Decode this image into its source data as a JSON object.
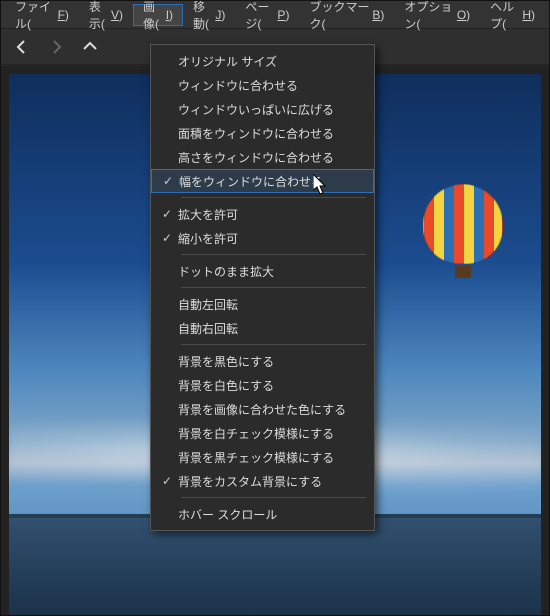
{
  "menubar": {
    "items": [
      {
        "label": "ファイル(F)"
      },
      {
        "label": "表示(V)"
      },
      {
        "label": "画像(I)",
        "active": true
      },
      {
        "label": "移動(J)"
      },
      {
        "label": "ページ(P)"
      },
      {
        "label": "ブックマーク(B)"
      },
      {
        "label": "オプション(O)"
      },
      {
        "label": "ヘルプ(H)"
      }
    ]
  },
  "toolbar": {
    "back_title": "戻る",
    "forward_title": "進む",
    "up_title": "上へ"
  },
  "dropdown": {
    "items": [
      {
        "label": "オリジナル サイズ"
      },
      {
        "label": "ウィンドウに合わせる"
      },
      {
        "label": "ウィンドウいっぱいに広げる"
      },
      {
        "label": "面積をウィンドウに合わせる"
      },
      {
        "label": "高さをウィンドウに合わせる"
      },
      {
        "label": "幅をウィンドウに合わせる",
        "checked": true,
        "highlight": true
      },
      {
        "sep": true
      },
      {
        "label": "拡大を許可",
        "checked": true
      },
      {
        "label": "縮小を許可",
        "checked": true
      },
      {
        "sep": true
      },
      {
        "label": "ドットのまま拡大"
      },
      {
        "sep": true
      },
      {
        "label": "自動左回転"
      },
      {
        "label": "自動右回転"
      },
      {
        "sep": true
      },
      {
        "label": "背景を黒色にする"
      },
      {
        "label": "背景を白色にする"
      },
      {
        "label": "背景を画像に合わせた色にする"
      },
      {
        "label": "背景を白チェック模様にする"
      },
      {
        "label": "背景を黒チェック模様にする"
      },
      {
        "label": "背景をカスタム背景にする",
        "checked": true
      },
      {
        "sep": true
      },
      {
        "label": "ホバー スクロール"
      }
    ]
  }
}
